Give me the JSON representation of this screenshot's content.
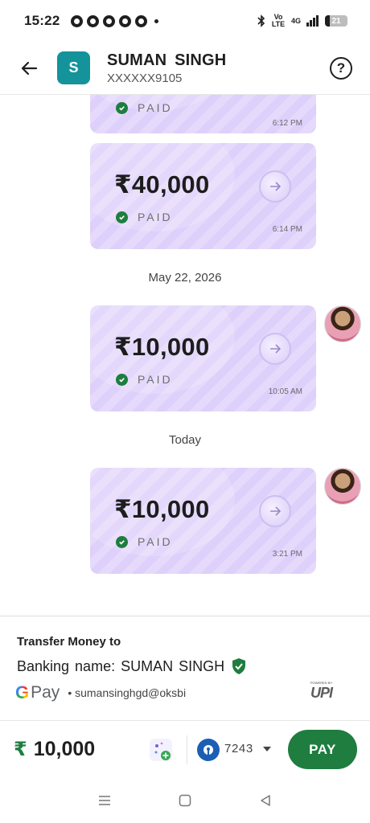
{
  "status_bar": {
    "time": "15:22",
    "volte": "Vo LTE",
    "network": "4G",
    "battery": "21"
  },
  "header": {
    "avatar_letter": "S",
    "name": "SUMAN  SINGH",
    "phone": "XXXXXX9105",
    "help": "?"
  },
  "messages": [
    {
      "amount": "",
      "status": "PAID",
      "time": "6:12 PM"
    },
    {
      "amount": "₹40,000",
      "status": "PAID",
      "time": "6:14 PM"
    },
    {
      "date_separator": "May 22, 2026"
    },
    {
      "amount": "₹10,000",
      "status": "PAID",
      "time": "10:05 AM"
    },
    {
      "date_separator": "Today"
    },
    {
      "amount": "₹10,000",
      "status": "PAID",
      "time": "3:21 PM"
    }
  ],
  "transfer": {
    "title": "Transfer Money to",
    "banking_name": "Banking name: SUMAN  SINGH",
    "gpay_g": "G",
    "gpay_pay": "Pay",
    "vpa": "• sumansinghgd@oksbi",
    "upi_powered": "POWERED BY",
    "upi_text": "UPI"
  },
  "pay_bar": {
    "currency": "₹",
    "amount": "10,000",
    "account_suffix": "7243",
    "pay_label": "PAY"
  },
  "colors": {
    "accent_green": "#1e7d3f",
    "avatar_teal": "#14939b",
    "card_purple": "#e6dafc"
  }
}
